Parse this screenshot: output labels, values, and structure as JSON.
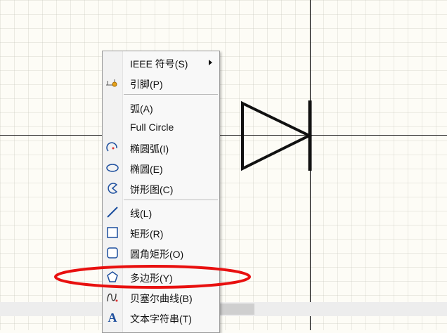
{
  "menu": {
    "items": [
      {
        "label": "IEEE 符号(S)",
        "icon": "none",
        "submenu": true
      },
      {
        "label": "引脚(P)",
        "icon": "pin-icon"
      },
      {
        "label": "弧(A)",
        "icon": "none"
      },
      {
        "label": "Full Circle",
        "icon": "none"
      },
      {
        "label": "椭圆弧(I)",
        "icon": "elliptical-arc-icon"
      },
      {
        "label": "椭圆(E)",
        "icon": "ellipse-icon"
      },
      {
        "label": "饼形图(C)",
        "icon": "pie-icon"
      },
      {
        "label": "线(L)",
        "icon": "line-icon"
      },
      {
        "label": "矩形(R)",
        "icon": "rectangle-icon"
      },
      {
        "label": "圆角矩形(O)",
        "icon": "round-rectangle-icon"
      },
      {
        "label": "多边形(Y)",
        "icon": "polygon-icon"
      },
      {
        "label": "贝塞尔曲线(B)",
        "icon": "bezier-icon"
      },
      {
        "label": "文本字符串(T)",
        "icon": "text-icon"
      }
    ]
  },
  "annotation": {
    "highlight_color": "#e8100f"
  }
}
